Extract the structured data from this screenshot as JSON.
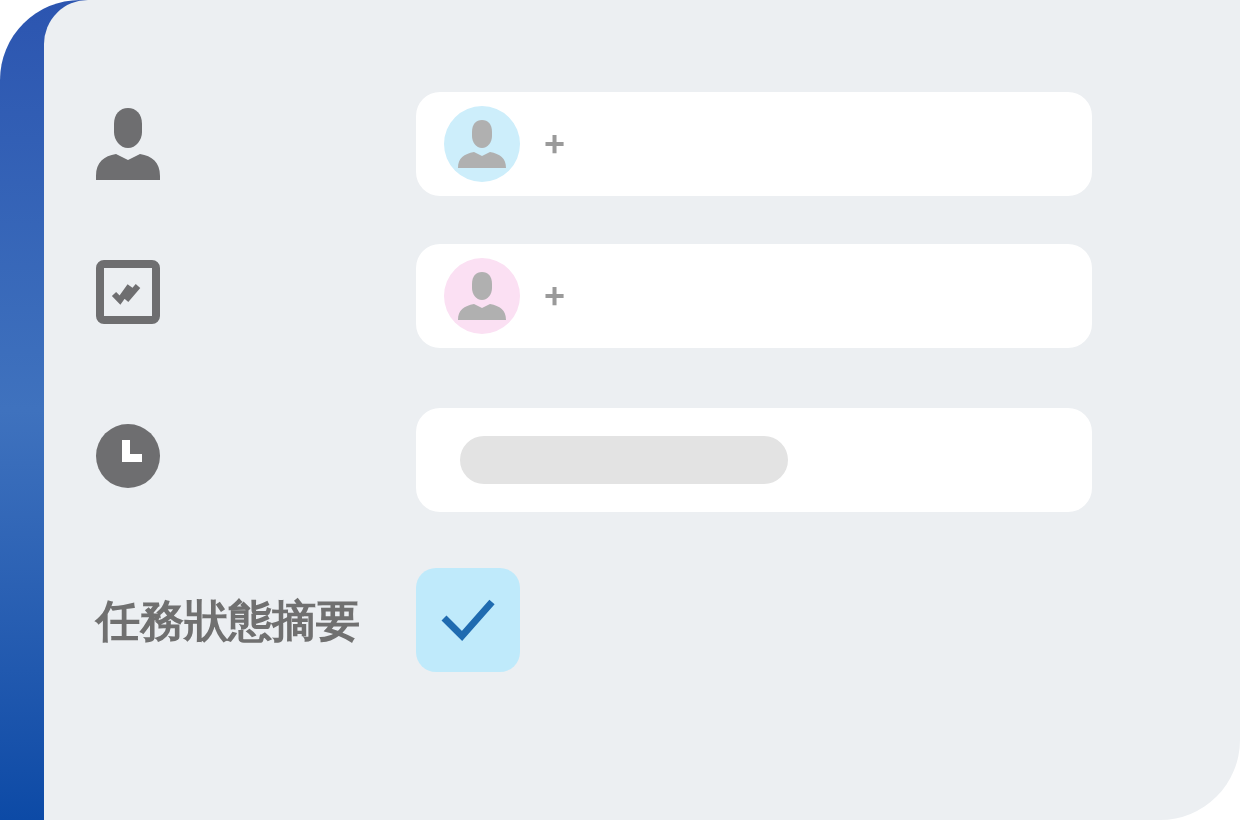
{
  "rows": [
    {
      "kind": "assignee",
      "color": "#cdeefb",
      "add": "+"
    },
    {
      "kind": "reviewer",
      "color": "#fbe0f3",
      "add": "+"
    },
    {
      "kind": "time"
    }
  ],
  "summary": {
    "label": "任務狀態摘要",
    "checked": true
  }
}
